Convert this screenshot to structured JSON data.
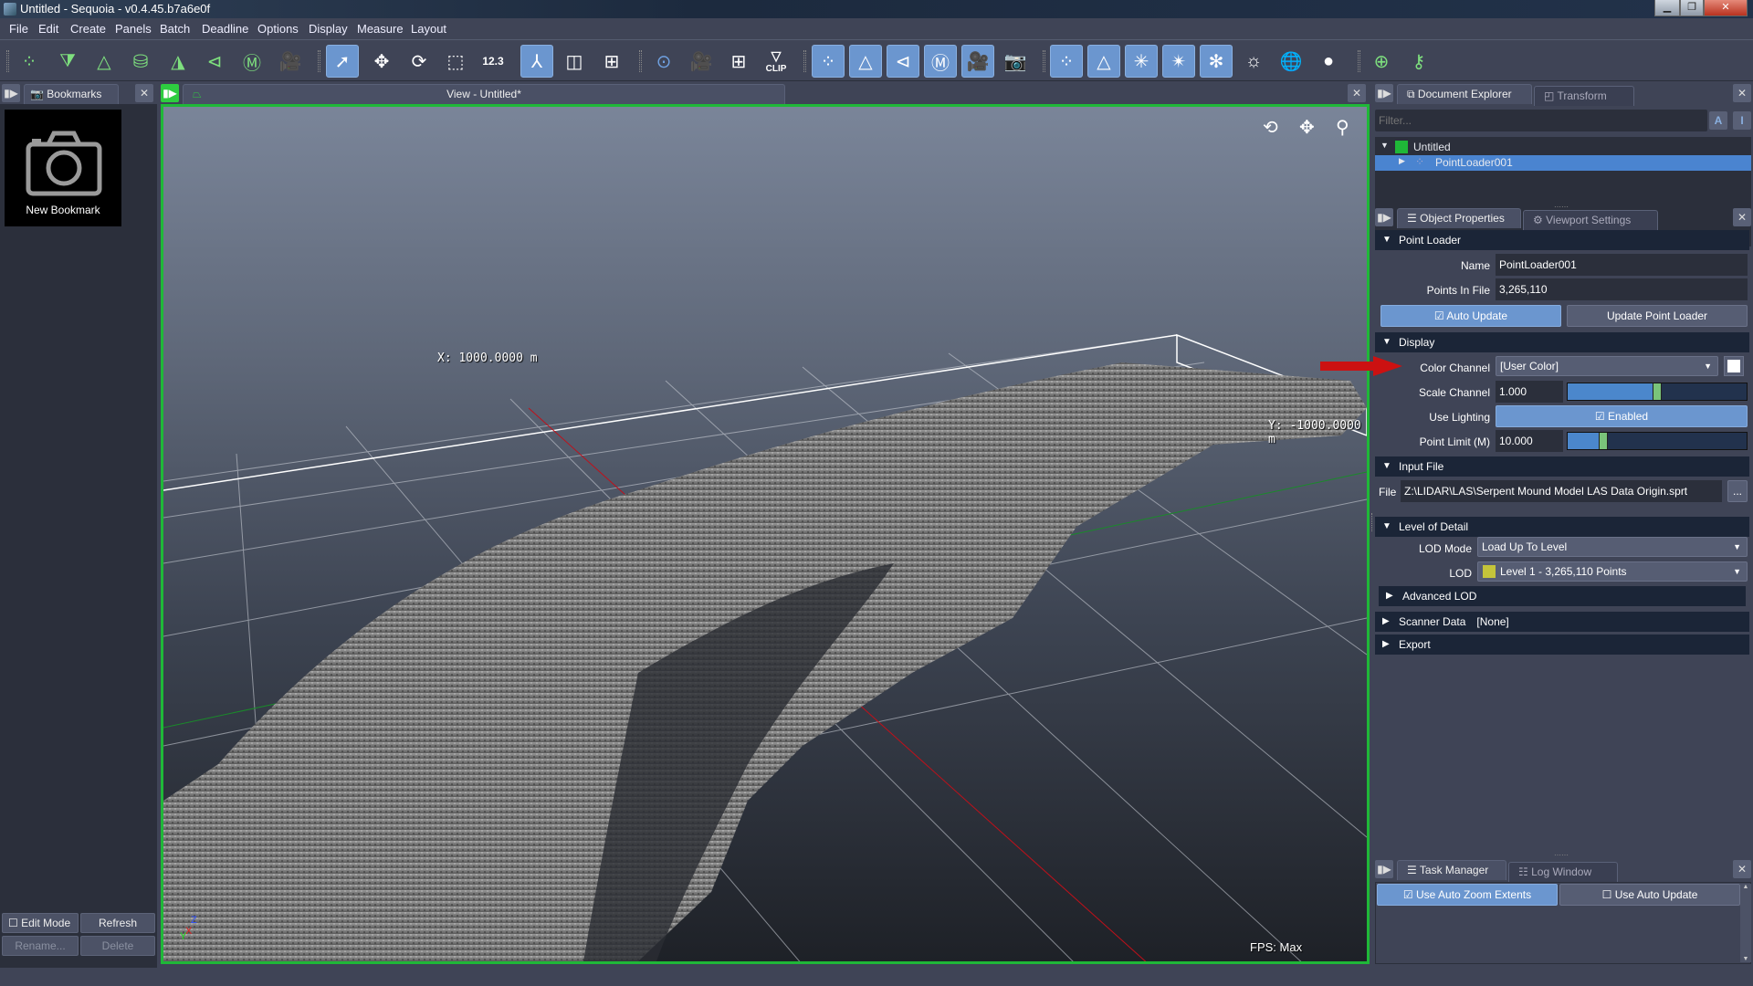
{
  "window": {
    "title": "Untitled - Sequoia - v0.4.45.b7a6e0f"
  },
  "menu": [
    "File",
    "Edit",
    "Create",
    "Panels",
    "Batch",
    "Deadline",
    "Options",
    "Display",
    "Measure",
    "Layout"
  ],
  "toolbar": {
    "create_group": [
      "add-point-loader-icon",
      "add-mesh-filter-icon",
      "add-mesher-icon",
      "add-ml-icon",
      "add-mesh-points-icon",
      "add-camera-frustum-icon",
      "add-marker-icon",
      "add-camera-icon"
    ],
    "transform_group": [
      {
        "icon": "select-arrow-icon",
        "active": true
      },
      {
        "icon": "move-icon",
        "active": false
      },
      {
        "icon": "rotate-icon",
        "active": false
      },
      {
        "icon": "scale-icon",
        "active": false
      },
      {
        "icon": "measure-icon",
        "active": false,
        "text": "12.3"
      }
    ],
    "view_group": [
      {
        "icon": "axis-view-icon",
        "active": true
      },
      {
        "icon": "perspective-cube-icon",
        "active": false
      },
      {
        "icon": "quad-view-icon",
        "active": false
      }
    ],
    "camera_group": [
      "zoom-extents-icon",
      "camera-ground-icon",
      "grid-floor-icon",
      "clip-icon"
    ],
    "clip_label": "CLIP",
    "visibility_group": [
      {
        "icon": "show-points-icon",
        "active": true
      },
      {
        "icon": "show-meshes-icon",
        "active": true
      },
      {
        "icon": "show-frustums-icon",
        "active": true
      },
      {
        "icon": "show-markers-icon",
        "active": true
      },
      {
        "icon": "show-cameras-icon",
        "active": true
      },
      {
        "icon": "show-camera-images-icon",
        "active": false
      }
    ],
    "render_group": [
      {
        "icon": "points-id-icon",
        "active": true
      },
      {
        "icon": "mesh-id-icon",
        "active": true
      },
      {
        "icon": "points-light-icon",
        "active": true
      },
      {
        "icon": "mesh-light-icon",
        "active": true
      },
      {
        "icon": "light-toggle-icon",
        "active": true
      },
      {
        "icon": "headlight-icon",
        "active": false
      },
      {
        "icon": "wireframe-sphere-icon",
        "active": false
      },
      {
        "icon": "shaded-sphere-icon",
        "active": false
      }
    ],
    "extra_group": [
      "add-ground-plane-icon",
      "add-key-icon"
    ]
  },
  "bookmarks": {
    "tab_label": "Bookmarks",
    "items": [
      {
        "label": "New Bookmark"
      }
    ],
    "edit_mode_label": "Edit Mode",
    "edit_mode_checked": false,
    "refresh_label": "Refresh",
    "rename_label": "Rename...",
    "delete_label": "Delete"
  },
  "viewport": {
    "tab_label": "View - Untitled*",
    "x_label": "X:  1000.0000  m",
    "y_label": "Y:  -1000.0000  m",
    "fps_label": "FPS:  Max",
    "axis": {
      "x": "X",
      "y": "Y",
      "z": "Z"
    }
  },
  "document_explorer": {
    "tabs": [
      {
        "label": "Document Explorer",
        "active": true
      },
      {
        "label": "Transform",
        "active": false
      }
    ],
    "filter_placeholder": "Filter...",
    "tree": [
      {
        "label": "Untitled",
        "color": "#1fb838",
        "expanded": true,
        "level": 0
      },
      {
        "label": "PointLoader001",
        "selected": true,
        "level": 1
      }
    ]
  },
  "properties": {
    "tabs": [
      {
        "label": "Object Properties",
        "active": true
      },
      {
        "label": "Viewport Settings",
        "active": false
      }
    ],
    "point_loader": {
      "title": "Point Loader",
      "name_label": "Name",
      "name_value": "PointLoader001",
      "points_label": "Points In File",
      "points_value": "3,265,110",
      "auto_update_label": "Auto Update",
      "auto_update_checked": true,
      "update_button": "Update Point Loader"
    },
    "display": {
      "title": "Display",
      "color_channel_label": "Color Channel",
      "color_channel_value": "[User Color]",
      "user_color": "#ffffff",
      "scale_channel_label": "Scale Channel",
      "scale_channel_value": "1.000",
      "scale_channel_fraction": 0.5,
      "use_lighting_label": "Use Lighting",
      "use_lighting_value": "Enabled",
      "use_lighting_checked": true,
      "point_limit_label": "Point Limit (M)",
      "point_limit_value": "10.000",
      "point_limit_fraction": 0.2
    },
    "input_file": {
      "title": "Input File",
      "file_label": "File",
      "file_value": "Z:\\LIDAR\\LAS\\Serpent Mound Model LAS Data Origin.sprt",
      "browse_label": "..."
    },
    "lod": {
      "title": "Level of Detail",
      "mode_label": "LOD Mode",
      "mode_value": "Load Up To Level",
      "lod_label": "LOD",
      "lod_value": "Level 1 - 3,265,110 Points",
      "lod_color": "#c4c43a",
      "advanced_label": "Advanced LOD"
    },
    "scanner_data": {
      "title": "Scanner Data",
      "value": "[None]"
    },
    "export": {
      "title": "Export"
    }
  },
  "task_manager": {
    "tabs": [
      {
        "label": "Task Manager",
        "active": true
      },
      {
        "label": "Log Window",
        "active": false
      }
    ],
    "auto_zoom_label": "Use Auto Zoom Extents",
    "auto_zoom_checked": true,
    "auto_update_label": "Use Auto Update",
    "auto_update_checked": false
  },
  "colors": {
    "accent": "#6b96cf",
    "viewport_border": "#1fb838",
    "selection": "#4a84d0",
    "annotation_arrow": "#cc1111"
  }
}
